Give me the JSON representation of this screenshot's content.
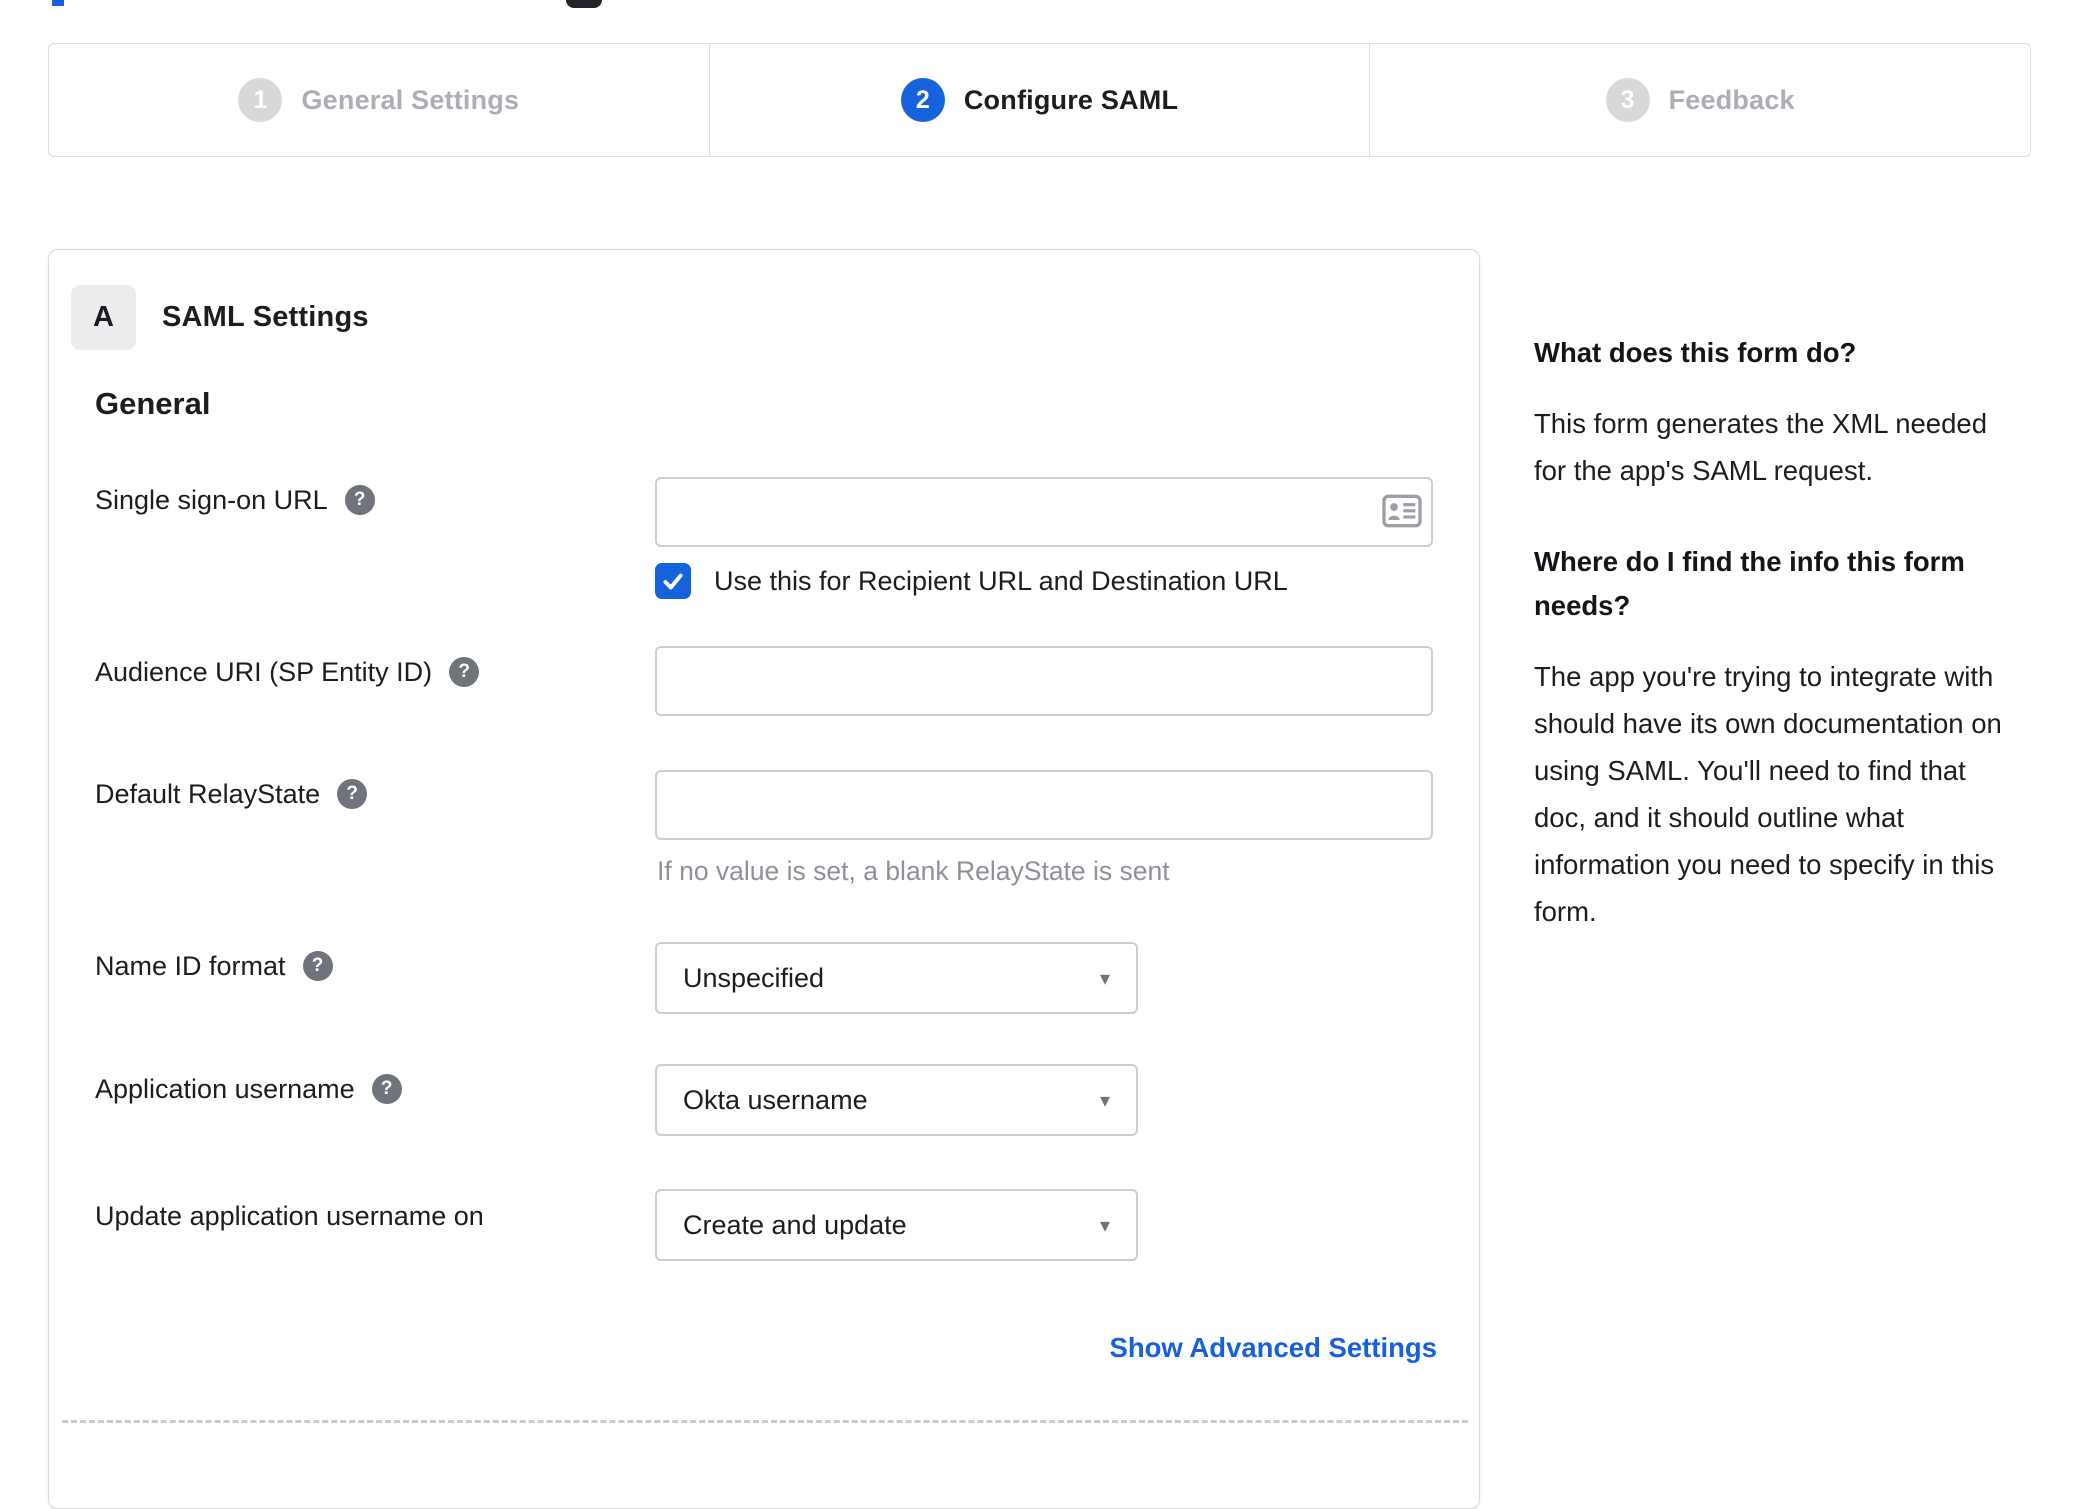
{
  "stepper": {
    "steps": [
      {
        "number": "1",
        "label": "General Settings",
        "state": "inactive"
      },
      {
        "number": "2",
        "label": "Configure SAML",
        "state": "active"
      },
      {
        "number": "3",
        "label": "Feedback",
        "state": "inactive"
      }
    ]
  },
  "panel": {
    "badge": "A",
    "title": "SAML Settings",
    "heading": "General",
    "fields": {
      "sso": {
        "label": "Single sign-on URL",
        "value": "",
        "checkbox_checked": true,
        "checkbox_label": "Use this for Recipient URL and Destination URL"
      },
      "audience": {
        "label": "Audience URI (SP Entity ID)",
        "value": ""
      },
      "relay": {
        "label": "Default RelayState",
        "value": "",
        "hint": "If no value is set, a blank RelayState is sent"
      },
      "name_id": {
        "label": "Name ID format",
        "value": "Unspecified"
      },
      "app_username": {
        "label": "Application username",
        "value": "Okta username"
      },
      "update_username": {
        "label": "Update application username on",
        "value": "Create and update"
      }
    },
    "advanced_link": "Show Advanced Settings"
  },
  "sidebar": {
    "q1": "What does this form do?",
    "a1": "This form generates the XML needed for the app's SAML request.",
    "q2": "Where do I find the info this form needs?",
    "a2": "The app you're trying to integrate with should have its own documentation on using SAML. You'll need to find that doc, and it should outline what information you need to specify in this form."
  },
  "icons": {
    "help": "?",
    "select_arrow": "▾",
    "sso_field_icon": "contact-card"
  },
  "colors": {
    "accent_blue": "#1662dd",
    "link_blue": "#1661de",
    "inactive_circle_gray": "#d6d8da",
    "inactive_label_gray": "#abaeb3",
    "help_icon_gray": "#6f737b",
    "input_border_gray": "#cdced1",
    "hint_gray": "#8e9197",
    "text": "#1d1d21"
  }
}
